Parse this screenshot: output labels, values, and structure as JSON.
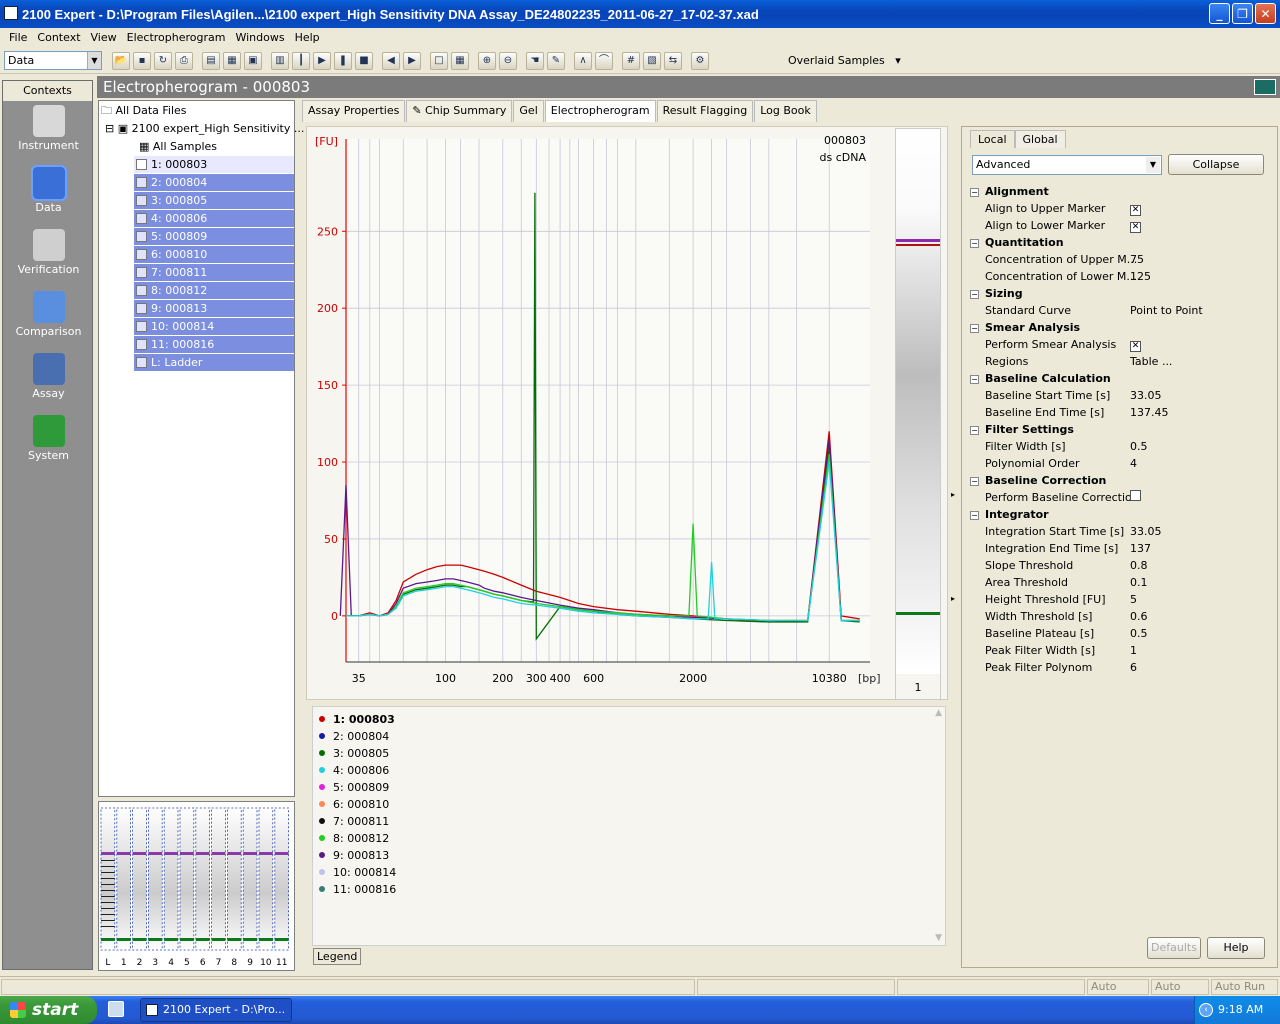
{
  "window": {
    "title": "2100 Expert - D:\\Program Files\\Agilen...\\2100 expert_High Sensitivity DNA Assay_DE24802235_2011-06-27_17-02-37.xad"
  },
  "menu": [
    "File",
    "Context",
    "View",
    "Electropherogram",
    "Windows",
    "Help"
  ],
  "toolbar": {
    "mode_select": "Data",
    "overlay_select": "Overlaid Samples"
  },
  "contexts": {
    "header": "Contexts",
    "items": [
      {
        "label": "Instrument",
        "icon": "instrument-icon"
      },
      {
        "label": "Data",
        "icon": "data-icon",
        "active": true
      },
      {
        "label": "Verification",
        "icon": "verification-icon"
      },
      {
        "label": "Comparison",
        "icon": "comparison-icon"
      },
      {
        "label": "Assay",
        "icon": "assay-icon"
      },
      {
        "label": "System",
        "icon": "system-icon"
      }
    ]
  },
  "header": {
    "title": "Electropherogram - 000803"
  },
  "tree": {
    "root": "All Data Files",
    "file": "2100 expert_High Sensitivity ...",
    "all_samples": "All Samples",
    "samples": [
      "1: 000803",
      "2: 000804",
      "3: 000805",
      "4: 000806",
      "5: 000809",
      "6: 000810",
      "7: 000811",
      "8: 000812",
      "9: 000813",
      "10: 000814",
      "11: 000816",
      "L: Ladder"
    ]
  },
  "gel_thumb_labels": [
    "L",
    "1",
    "2",
    "3",
    "4",
    "5",
    "6",
    "7",
    "8",
    "9",
    "10",
    "11"
  ],
  "tabs": [
    "Assay Properties",
    "Chip Summary",
    "Gel",
    "Electropherogram",
    "Result Flagging",
    "Log Book"
  ],
  "chart_data": {
    "type": "line",
    "ylabel": "[FU]",
    "xlabel": "[bp]",
    "title": "000803",
    "subtitle": "ds cDNA",
    "ylim": [
      -30,
      310
    ],
    "y_ticks": [
      0,
      50,
      100,
      150,
      200,
      250
    ],
    "x_tick_labels": [
      "35",
      "100",
      "200",
      "300",
      "400",
      "600",
      "2000",
      "10380"
    ],
    "grid": true,
    "series": [
      {
        "name": "1: 000803",
        "color": "#cc0000",
        "x": [
          30,
          35,
          40,
          45,
          50,
          55,
          60,
          70,
          80,
          90,
          100,
          110,
          120,
          130,
          140,
          150,
          160,
          170,
          180,
          200,
          250,
          300,
          400,
          500,
          600,
          800,
          1000,
          1500,
          2000,
          3000,
          5000,
          8000,
          10380,
          12000,
          15000
        ],
        "y": [
          0,
          0,
          2,
          0,
          2,
          10,
          22,
          27,
          30,
          32,
          33,
          33,
          33,
          32,
          31,
          30,
          29,
          28,
          27,
          25,
          20,
          16,
          12,
          8,
          6,
          4,
          3,
          1,
          0,
          -2,
          -4,
          -3,
          120,
          0,
          -2
        ]
      },
      {
        "name": "3: 000805",
        "color": "#007000",
        "x": [
          30,
          35,
          40,
          45,
          50,
          55,
          60,
          70,
          80,
          90,
          100,
          110,
          120,
          130,
          140,
          150,
          160,
          170,
          180,
          200,
          250,
          290,
          295,
          300,
          400,
          500,
          600,
          800,
          1000,
          1500,
          2000,
          3000,
          5000,
          8000,
          10380,
          12000,
          15000
        ],
        "y": [
          0,
          0,
          1,
          0,
          1,
          6,
          14,
          17,
          18,
          19,
          20,
          20,
          19,
          19,
          18,
          17,
          16,
          15,
          14,
          13,
          10,
          9,
          275,
          -15,
          6,
          4,
          3,
          1,
          0,
          -1,
          -2,
          -3,
          -4,
          -4,
          110,
          -3,
          -4
        ]
      },
      {
        "name": "9: 000813",
        "color": "#5a1a8a",
        "x": [
          28,
          30,
          32,
          35,
          40,
          45,
          50,
          55,
          60,
          70,
          80,
          90,
          100,
          110,
          120,
          130,
          140,
          150,
          160,
          170,
          180,
          200,
          250,
          300,
          400,
          500,
          600,
          800,
          1000,
          1500,
          2000,
          3000,
          5000,
          8000,
          10380,
          12000,
          15000
        ],
        "y": [
          0,
          85,
          0,
          0,
          1,
          0,
          1,
          8,
          18,
          21,
          22,
          23,
          24,
          24,
          23,
          22,
          21,
          20,
          18,
          17,
          16,
          15,
          12,
          10,
          7,
          5,
          4,
          2,
          1,
          0,
          -1,
          -2,
          -3,
          -3,
          115,
          -3,
          -3
        ]
      },
      {
        "name": "8: 000812",
        "color": "#22cc22",
        "x": [
          30,
          35,
          40,
          45,
          50,
          55,
          60,
          70,
          80,
          90,
          100,
          110,
          120,
          130,
          140,
          150,
          160,
          170,
          180,
          200,
          250,
          300,
          400,
          500,
          600,
          800,
          1000,
          1500,
          1900,
          2000,
          2100,
          3000,
          5000,
          8000,
          10380,
          12000,
          15000
        ],
        "y": [
          0,
          0,
          1,
          0,
          1,
          6,
          15,
          18,
          19,
          20,
          21,
          21,
          20,
          19,
          18,
          17,
          16,
          15,
          14,
          13,
          10,
          8,
          6,
          4,
          3,
          2,
          1,
          0,
          0,
          60,
          0,
          -2,
          -3,
          -3,
          105,
          -3,
          -3
        ]
      },
      {
        "name": "4: 000806",
        "color": "#20d0e0",
        "x": [
          30,
          35,
          40,
          45,
          50,
          55,
          60,
          70,
          80,
          90,
          100,
          110,
          120,
          130,
          140,
          150,
          160,
          170,
          180,
          200,
          250,
          300,
          400,
          500,
          600,
          800,
          1000,
          1500,
          2000,
          2400,
          2500,
          2600,
          3000,
          5000,
          8000,
          10380,
          12000,
          15000
        ],
        "y": [
          0,
          0,
          1,
          0,
          1,
          5,
          13,
          16,
          17,
          18,
          19,
          19,
          18,
          17,
          16,
          15,
          14,
          13,
          12,
          11,
          8,
          7,
          5,
          3,
          2,
          1,
          0,
          -1,
          -2,
          -2,
          35,
          -2,
          -2,
          -3,
          -3,
          100,
          -3,
          -3
        ]
      }
    ]
  },
  "lane": {
    "label": "1"
  },
  "legend": {
    "items": [
      {
        "label": "1: 000803",
        "color": "#cc0000",
        "bold": true
      },
      {
        "label": "2: 000804",
        "color": "#1a1aaa"
      },
      {
        "label": "3: 000805",
        "color": "#007000"
      },
      {
        "label": "4: 000806",
        "color": "#20d0e0"
      },
      {
        "label": "5: 000809",
        "color": "#dd22dd"
      },
      {
        "label": "6: 000810",
        "color": "#ff8855"
      },
      {
        "label": "7: 000811",
        "color": "#111111"
      },
      {
        "label": "8: 000812",
        "color": "#22cc22"
      },
      {
        "label": "9: 000813",
        "color": "#5a1a8a"
      },
      {
        "label": "10: 000814",
        "color": "#c0c0ee"
      },
      {
        "label": "11: 000816",
        "color": "#3a7a7a"
      }
    ],
    "button": "Legend"
  },
  "panel": {
    "tabs": [
      "Local",
      "Global"
    ],
    "preset": "Advanced",
    "collapse": "Collapse",
    "defaults": "Defaults",
    "help": "Help",
    "groups": [
      {
        "name": "Alignment",
        "props": [
          [
            "Align to Upper Marker",
            "check"
          ],
          [
            "Align to Lower Marker",
            "check"
          ]
        ]
      },
      {
        "name": "Quantitation",
        "props": [
          [
            "Concentration of Upper M...",
            "75"
          ],
          [
            "Concentration of Lower M...",
            "125"
          ]
        ]
      },
      {
        "name": "Sizing",
        "props": [
          [
            "Standard Curve",
            "Point to Point"
          ]
        ]
      },
      {
        "name": "Smear Analysis",
        "props": [
          [
            "Perform Smear Analysis",
            "check"
          ],
          [
            "Regions",
            "Table ..."
          ]
        ]
      },
      {
        "name": "Baseline Calculation",
        "props": [
          [
            "Baseline Start Time [s]",
            "33.05"
          ],
          [
            "Baseline End Time [s]",
            "137.45"
          ]
        ]
      },
      {
        "name": "Filter Settings",
        "props": [
          [
            "Filter Width [s]",
            "0.5"
          ],
          [
            "Polynomial Order",
            "4"
          ]
        ]
      },
      {
        "name": "Baseline Correction",
        "props": [
          [
            "Perform Baseline Correction",
            "uncheck"
          ]
        ]
      },
      {
        "name": "Integrator",
        "props": [
          [
            "Integration Start Time [s]",
            "33.05"
          ],
          [
            "Integration End Time [s]",
            "137"
          ],
          [
            "Slope Threshold",
            "0.8"
          ],
          [
            "Area Threshold",
            "0.1"
          ],
          [
            "Height Threshold [FU]",
            "5"
          ],
          [
            "Width Threshold [s]",
            "0.6"
          ],
          [
            "Baseline Plateau [s]",
            "0.5"
          ],
          [
            "Peak Filter Width [s]",
            "1"
          ],
          [
            "Peak Filter Polynom",
            "6"
          ]
        ]
      }
    ]
  },
  "status": {
    "auto_export": "Auto Export",
    "auto_print": "Auto Print",
    "auto_run": "Auto Run"
  },
  "taskbar": {
    "start": "start",
    "task": "2100 Expert - D:\\Pro...",
    "clock": "9:18 AM"
  }
}
